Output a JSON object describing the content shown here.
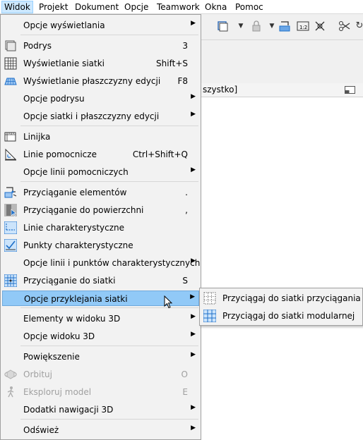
{
  "menubar": [
    "Widok",
    "Projekt",
    "Dokument",
    "Opcje",
    "Teamwork",
    "Okna",
    "Pomoc"
  ],
  "background": {
    "filter_text": "szystko]"
  },
  "menu": {
    "items": [
      {
        "label": "Opcje wyświetlania",
        "shortcut": "",
        "submenu": true,
        "icon": "",
        "disabled": false
      },
      {
        "label": "Podrys",
        "shortcut": "3",
        "submenu": false,
        "icon": "trace-icon",
        "disabled": false
      },
      {
        "label": "Wyświetlanie siatki",
        "shortcut": "Shift+S",
        "submenu": false,
        "icon": "grid-display-icon",
        "disabled": false
      },
      {
        "label": "Wyświetlanie płaszczyzny edycji",
        "shortcut": "F8",
        "submenu": false,
        "icon": "edit-plane-icon",
        "disabled": false
      },
      {
        "label": "Opcje podrysu",
        "shortcut": "",
        "submenu": true,
        "icon": "",
        "disabled": false
      },
      {
        "label": "Opcje siatki i płaszczyzny edycji",
        "shortcut": "",
        "submenu": true,
        "icon": "",
        "disabled": false
      },
      {
        "label": "Linijka",
        "shortcut": "",
        "submenu": false,
        "icon": "ruler-icon",
        "disabled": false
      },
      {
        "label": "Linie pomocnicze",
        "shortcut": "Ctrl+Shift+Q",
        "submenu": false,
        "icon": "guide-lines-icon",
        "disabled": false
      },
      {
        "label": "Opcje linii pomocniczych",
        "shortcut": "",
        "submenu": true,
        "icon": "",
        "disabled": false
      },
      {
        "label": "Przyciąganie elementów",
        "shortcut": ".",
        "submenu": false,
        "icon": "element-snap-icon",
        "disabled": false
      },
      {
        "label": "Przyciąganie do powierzchni",
        "shortcut": ",",
        "submenu": false,
        "icon": "surface-snap-icon",
        "disabled": false
      },
      {
        "label": "Linie charakterystyczne",
        "shortcut": "",
        "submenu": false,
        "icon": "feature-lines-icon",
        "disabled": false
      },
      {
        "label": "Punkty charakterystyczne",
        "shortcut": "",
        "submenu": false,
        "icon": "feature-points-icon",
        "disabled": false
      },
      {
        "label": "Opcje linii i punktów charakterystycznych",
        "shortcut": "",
        "submenu": true,
        "icon": "",
        "disabled": false
      },
      {
        "label": "Przyciąganie do siatki",
        "shortcut": "S",
        "submenu": false,
        "icon": "grid-snap-icon",
        "disabled": false
      },
      {
        "label": "Opcje przyklejania siatki",
        "shortcut": "",
        "submenu": true,
        "icon": "",
        "disabled": false
      },
      {
        "label": "Elementy w widoku 3D",
        "shortcut": "",
        "submenu": true,
        "icon": "",
        "disabled": false
      },
      {
        "label": "Opcje widoku 3D",
        "shortcut": "",
        "submenu": true,
        "icon": "",
        "disabled": false
      },
      {
        "label": "Powiększenie",
        "shortcut": "",
        "submenu": true,
        "icon": "",
        "disabled": false
      },
      {
        "label": "Orbituj",
        "shortcut": "O",
        "submenu": false,
        "icon": "orbit-icon",
        "disabled": true
      },
      {
        "label": "Eksploruj model",
        "shortcut": "E",
        "submenu": false,
        "icon": "explore-icon",
        "disabled": true
      },
      {
        "label": "Dodatki nawigacji 3D",
        "shortcut": "",
        "submenu": true,
        "icon": "",
        "disabled": false
      },
      {
        "label": "Odśwież",
        "shortcut": "",
        "submenu": true,
        "icon": "",
        "disabled": false
      }
    ]
  },
  "submenu": {
    "items": [
      {
        "label": "Przyciągaj do siatki przyciągania",
        "icon": "snap-grid-icon"
      },
      {
        "label": "Przyciągaj do siatki modularnej",
        "icon": "modular-grid-icon"
      }
    ]
  },
  "colors": {
    "highlight": "#91c9f7",
    "menubar_active": "#cce8ff",
    "icon_blue": "#1e6fc8"
  }
}
